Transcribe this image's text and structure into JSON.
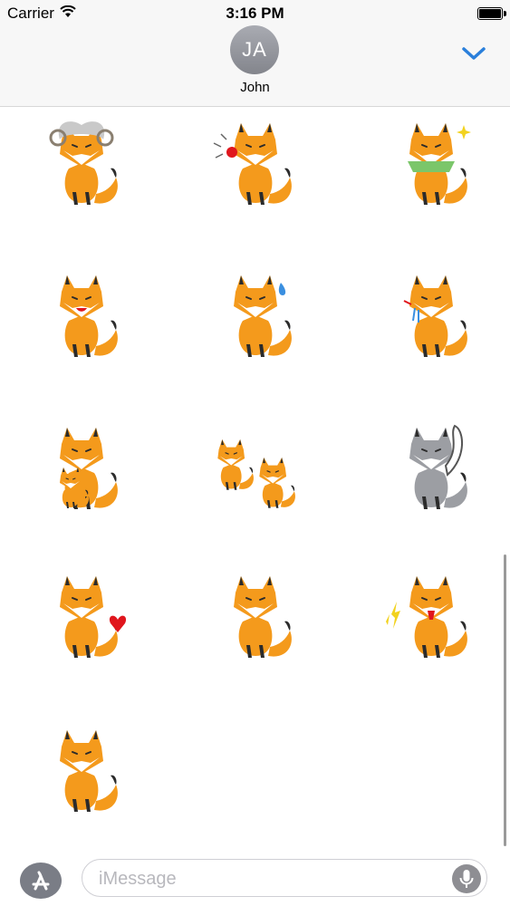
{
  "status_bar": {
    "carrier": "Carrier",
    "time": "3:16 PM"
  },
  "header": {
    "avatar_initials": "JA",
    "contact_name": "John"
  },
  "stickers": [
    {
      "name": "sticker-fox-ram-costume",
      "variant": "costume"
    },
    {
      "name": "sticker-fox-shouting",
      "variant": "shout"
    },
    {
      "name": "sticker-fox-money-fan",
      "variant": "money"
    },
    {
      "name": "sticker-fox-smiling",
      "variant": "smile"
    },
    {
      "name": "sticker-fox-sweat-drop",
      "variant": "sweat"
    },
    {
      "name": "sticker-fox-crying",
      "variant": "cry"
    },
    {
      "name": "sticker-fox-with-kit",
      "variant": "family"
    },
    {
      "name": "sticker-foxes-fighting",
      "variant": "fight"
    },
    {
      "name": "sticker-fox-gray-ghost",
      "variant": "gray"
    },
    {
      "name": "sticker-fox-hearts",
      "variant": "heart"
    },
    {
      "name": "sticker-fox-standing",
      "variant": "stand"
    },
    {
      "name": "sticker-fox-angry-lightning",
      "variant": "angry"
    },
    {
      "name": "sticker-fox-sitting",
      "variant": "sit"
    }
  ],
  "composer": {
    "placeholder": "iMessage"
  },
  "colors": {
    "fox_orange": "#f49a1c",
    "accent_blue": "#2a7fdb",
    "gray_fox": "#9c9ea3"
  }
}
